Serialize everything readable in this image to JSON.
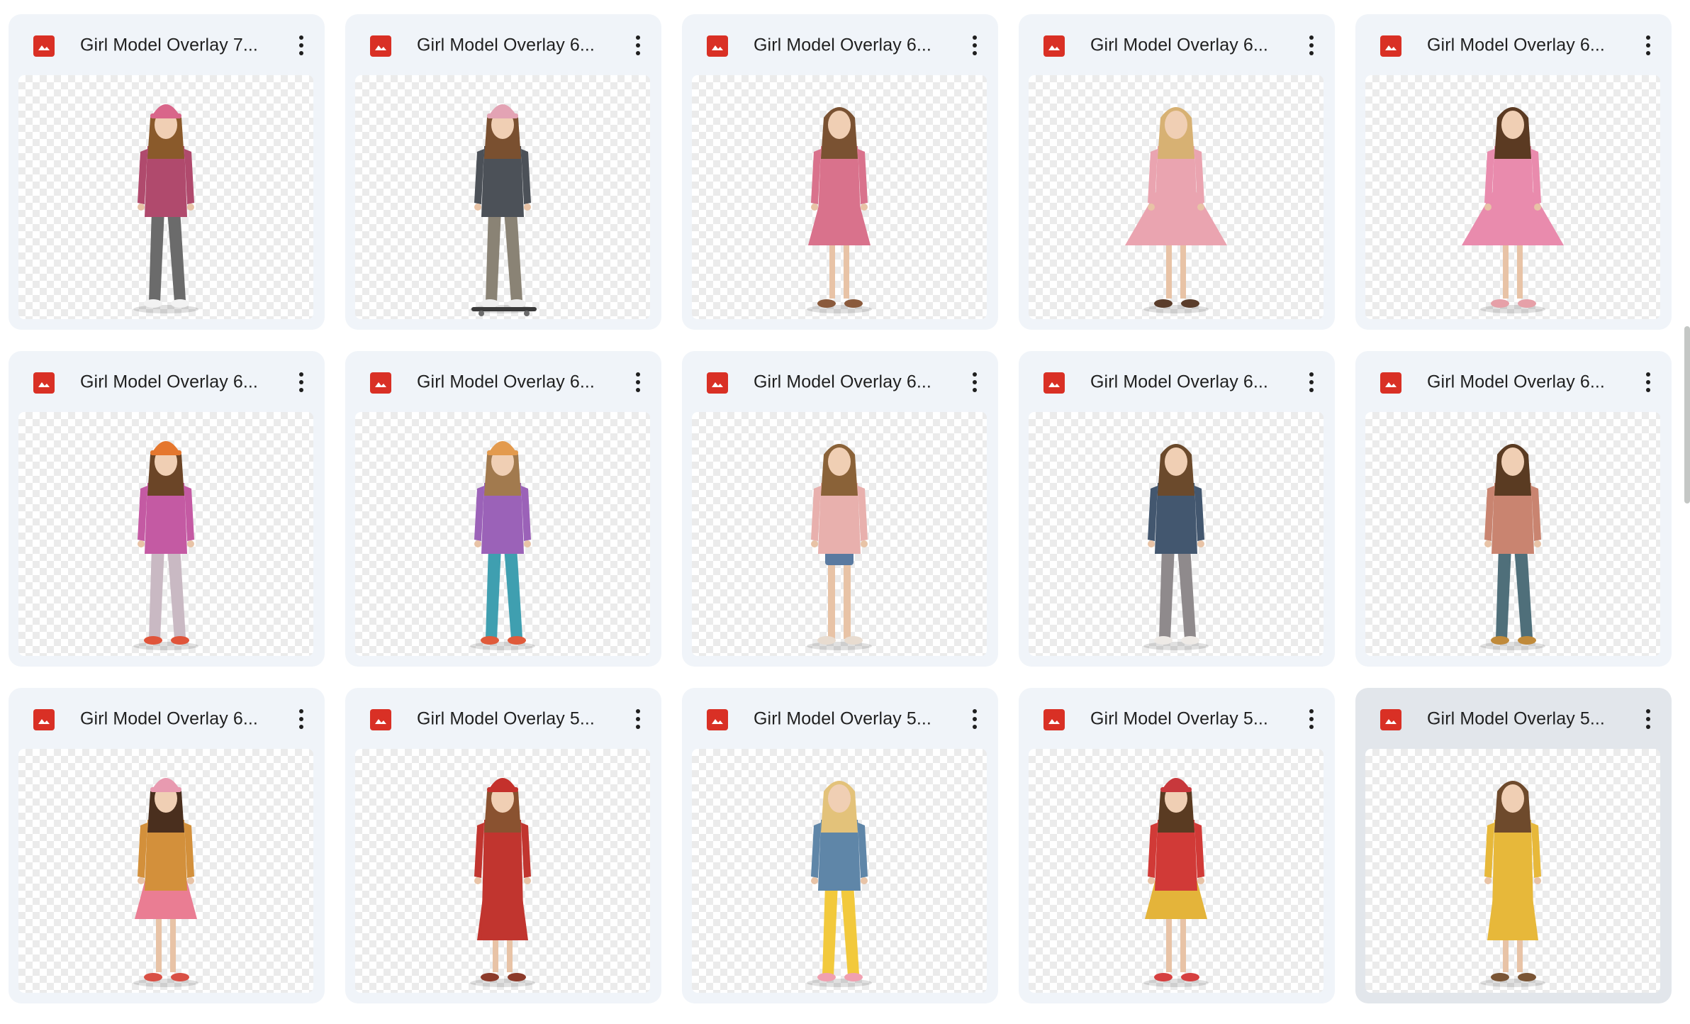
{
  "files": [
    {
      "title": "Girl Model Overlay 7...",
      "icon": "image-file-icon",
      "hat": "#d9668a",
      "hair": "#8a5a2b",
      "top": "#b04a6d",
      "bottom": "#6b6b6b",
      "shoes": "#f2f2f2",
      "style": "pants"
    },
    {
      "title": "Girl Model Overlay 6...",
      "icon": "image-file-icon",
      "hat": "#e3a3b4",
      "hair": "#7a5030",
      "top": "#4c5158",
      "bottom": "#8a8375",
      "shoes": "#eeeeee",
      "style": "skate"
    },
    {
      "title": "Girl Model Overlay 6...",
      "icon": "image-file-icon",
      "hat": "",
      "hair": "#7a5232",
      "top": "#d9728c",
      "bottom": "#d9728c",
      "shoes": "#8a5a3c",
      "style": "dress"
    },
    {
      "title": "Girl Model Overlay 6...",
      "icon": "image-file-icon",
      "hat": "",
      "hair": "#d7b173",
      "top": "#eaa4b0",
      "bottom": "#eaa4b0",
      "shoes": "#5a3d2b",
      "style": "gown"
    },
    {
      "title": "Girl Model Overlay 6...",
      "icon": "image-file-icon",
      "hat": "",
      "hair": "#5b3a22",
      "top": "#e98bad",
      "bottom": "#e98bad",
      "shoes": "#e6a0a8",
      "style": "gown"
    },
    {
      "title": "Girl Model Overlay 6...",
      "icon": "image-file-icon",
      "hat": "#e5772e",
      "hair": "#6b4527",
      "top": "#c45aa3",
      "bottom": "#c9b9c3",
      "shoes": "#e0543a",
      "style": "pants"
    },
    {
      "title": "Girl Model Overlay 6...",
      "icon": "image-file-icon",
      "hat": "#e39a4d",
      "hair": "#a27a4e",
      "top": "#9b62b8",
      "bottom": "#3f9fb0",
      "shoes": "#e05a3a",
      "style": "pants"
    },
    {
      "title": "Girl Model Overlay 6...",
      "icon": "image-file-icon",
      "hat": "",
      "hair": "#8a6238",
      "top": "#e8b0ad",
      "bottom": "#5a7aa0",
      "shoes": "#e8dcd0",
      "style": "shorts"
    },
    {
      "title": "Girl Model Overlay 6...",
      "icon": "image-file-icon",
      "hat": "",
      "hair": "#6b4a2c",
      "top": "#43576f",
      "bottom": "#8f8a8c",
      "shoes": "#eeeae6",
      "style": "pants"
    },
    {
      "title": "Girl Model Overlay 6...",
      "icon": "image-file-icon",
      "hat": "",
      "hair": "#5a3b22",
      "top": "#c98470",
      "bottom": "#4f6f7a",
      "shoes": "#c08a3a",
      "style": "pants"
    },
    {
      "title": "Girl Model Overlay 6...",
      "icon": "image-file-icon",
      "hat": "#e89ab0",
      "hair": "#4a2f1e",
      "top": "#d3903b",
      "bottom": "#ea7d93",
      "shoes": "#d95045",
      "style": "dress"
    },
    {
      "title": "Girl Model Overlay 5...",
      "icon": "image-file-icon",
      "hat": "#c4312c",
      "hair": "#8a5230",
      "top": "#c1352f",
      "bottom": "#c1352f",
      "shoes": "#8c3a2a",
      "style": "coat"
    },
    {
      "title": "Girl Model Overlay 5...",
      "icon": "image-file-icon",
      "hat": "",
      "hair": "#e3c27a",
      "top": "#5f86a8",
      "bottom": "#f2c93c",
      "shoes": "#f0a0b0",
      "style": "pants"
    },
    {
      "title": "Girl Model Overlay 5...",
      "icon": "image-file-icon",
      "hat": "#c8383c",
      "hair": "#5a3b22",
      "top": "#d13a37",
      "bottom": "#e4b43a",
      "shoes": "#d64040",
      "style": "dress"
    },
    {
      "title": "Girl Model Overlay 5...",
      "icon": "image-file-icon",
      "hat": "",
      "hair": "#6e4a2c",
      "top": "#e7b83a",
      "bottom": "#e7b83a",
      "shoes": "#7a5535",
      "style": "coat",
      "hovered": true
    }
  ]
}
